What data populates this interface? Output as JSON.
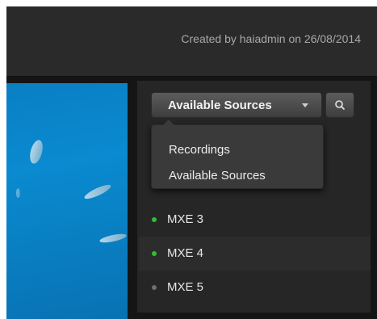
{
  "header": {
    "created_text": "Created by haiadmin on 26/08/2014"
  },
  "sources": {
    "dropdown_label": "Available Sources",
    "search_icon": "search-icon",
    "menu": [
      {
        "label": "Recordings"
      },
      {
        "label": "Available Sources"
      }
    ],
    "list": [
      {
        "label": "MXE 3",
        "status": "online",
        "color": "#2fbf2f"
      },
      {
        "label": "MXE 4",
        "status": "online",
        "color": "#2fbf2f"
      },
      {
        "label": "MXE 5",
        "status": "offline",
        "color": "#6e6e6e"
      }
    ]
  },
  "colors": {
    "background": "#151515",
    "topbar": "#2a2a2a",
    "video_water": "#0a8ad0"
  }
}
